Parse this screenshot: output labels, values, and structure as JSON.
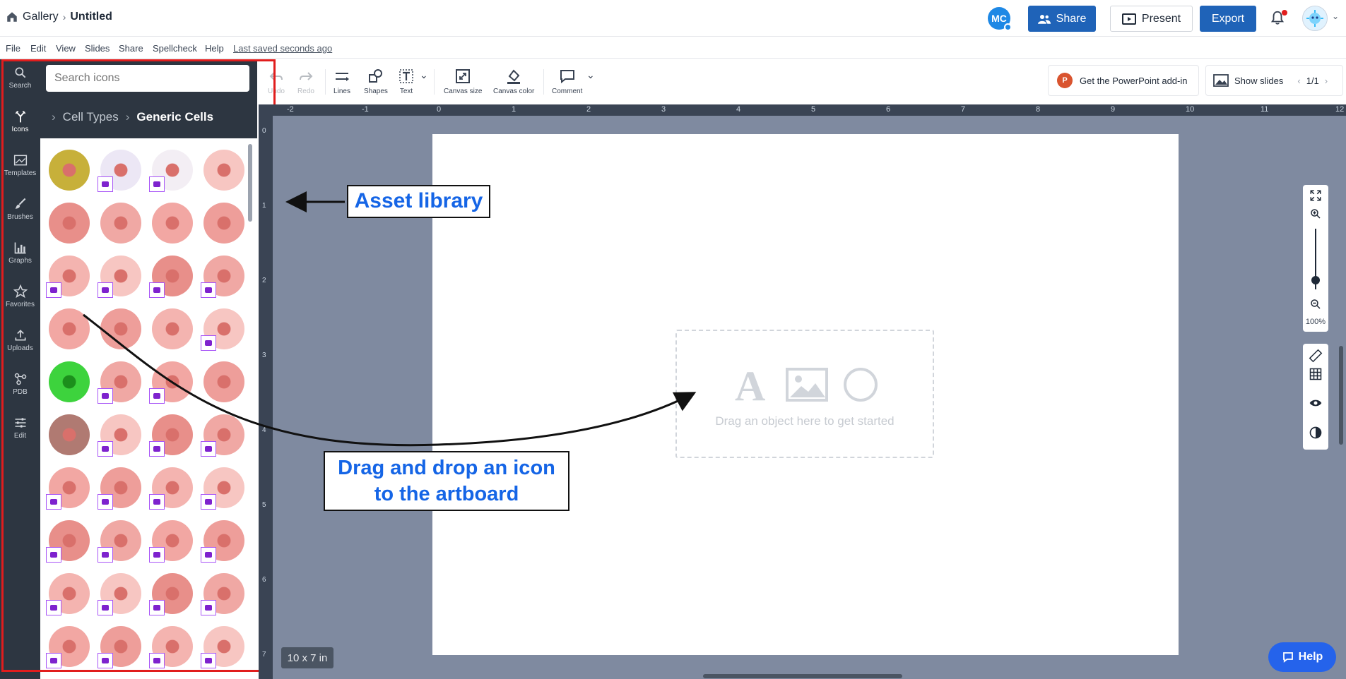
{
  "topbar": {
    "gallery": "Gallery",
    "doc_title": "Untitled",
    "avatar_initials": "MC",
    "share": "Share",
    "present": "Present",
    "export": "Export"
  },
  "menu": {
    "items": [
      "File",
      "Edit",
      "View",
      "Slides",
      "Share",
      "Spellcheck",
      "Help"
    ],
    "last_saved": "Last saved seconds ago"
  },
  "toolbar": {
    "undo": "Undo",
    "redo": "Redo",
    "lines": "Lines",
    "shapes": "Shapes",
    "text": "Text",
    "canvas_size": "Canvas size",
    "canvas_color": "Canvas color",
    "comment": "Comment",
    "ppt_addin": "Get the PowerPoint add-in",
    "show_slides": "Show slides",
    "slide_counter": "1/1"
  },
  "leftrail": {
    "items": [
      "Search",
      "Icons",
      "Templates",
      "Brushes",
      "Graphs",
      "Favorites",
      "Uploads",
      "PDB",
      "Edit"
    ]
  },
  "library": {
    "search_placeholder": "Search icons",
    "crumb_parent": "Cell Types",
    "crumb_current": "Generic Cells"
  },
  "ruler": {
    "top_labels": [
      "-2",
      "-1",
      "0",
      "1",
      "2",
      "3",
      "4",
      "5",
      "6",
      "7",
      "8",
      "9",
      "10",
      "11",
      "12"
    ],
    "left_labels": [
      "0",
      "1",
      "2",
      "3",
      "4",
      "5",
      "6",
      "7"
    ]
  },
  "canvas": {
    "drop_text": "Drag an object here to get started",
    "size_badge": "10 x 7 in",
    "zoom": "100%",
    "help": "Help"
  },
  "annotations": {
    "asset_library": "Asset library",
    "drag_line1": "Drag and drop an icon",
    "drag_line2": "to the artboard"
  },
  "colors": {
    "brand_blue": "#1f63b8",
    "rail_bg": "#2d3641",
    "canvas_bg": "#7f8aa0",
    "annotation_red": "#e11d1d",
    "annotation_blue": "#1565e6"
  }
}
